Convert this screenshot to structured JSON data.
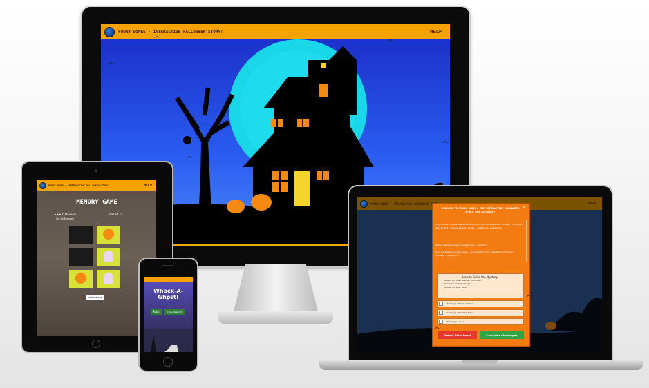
{
  "colors": {
    "accent_orange": "#f6a300",
    "sky_blue": "#1d3fe0",
    "moon_cyan": "#19d6e8",
    "pumpkin": "#f48a12",
    "btn_red": "#e23a2c",
    "btn_green": "#2fa543"
  },
  "desktop": {
    "site_title": "FUNNY BONES - INTERACTIVE HALLOWEEN STORY!",
    "help": "HELP"
  },
  "tablet": {
    "site_title": "FUNNY BONES - INTERACTIVE HALLOWEEN STORY!",
    "help": "HELP",
    "game_title": "MEMORY GAME",
    "stars": "★★★",
    "stars_label": "0 Move(s)",
    "time_label": "0m 0s Elapsed",
    "restart": "Restart ↻",
    "instructions": "Instructions",
    "cards": [
      "",
      "pumpkin",
      "",
      "ghost",
      "pumpkin",
      "ghost"
    ]
  },
  "phone": {
    "game_title": "Whack-A-Ghost!",
    "score": "0",
    "start": "Start",
    "instructions": "Instructions"
  },
  "laptop": {
    "site_title": "FUNNY BONES - INTERACTIVE HALLOWEEN STORY!",
    "help": "HELP",
    "modal": {
      "title": "WELCOME TO FUNNY BONES: THE INTERACTIVE HALLOWEEN STORY FOR CHILDREN!",
      "close": "×",
      "p1": "Hello, this is Funny Bones and Marcus, your journey starts from the sky! The map is easy to find ... the old haunted house ... explore the mysterious.",
      "p2": "Read & strange things are happening ... this find ...",
      "p3": "Here are the keys to the house ... it is haunted and ... inside the old house ... although it is quite old ...",
      "how_title": "How to Solve the Mystery:",
      "how_items": [
        "Search the map to enter the house",
        "Complete all 3 challenges",
        "Unlock the Attic Door!"
      ],
      "challenges": [
        "Challenge: Whack-A-Ghost",
        "Challenge: Matching Pairs",
        "Challenge: Jump!"
      ],
      "unlock_btn": "Unlock Attic Door!",
      "complete_btn": "Complete Challenges"
    }
  }
}
